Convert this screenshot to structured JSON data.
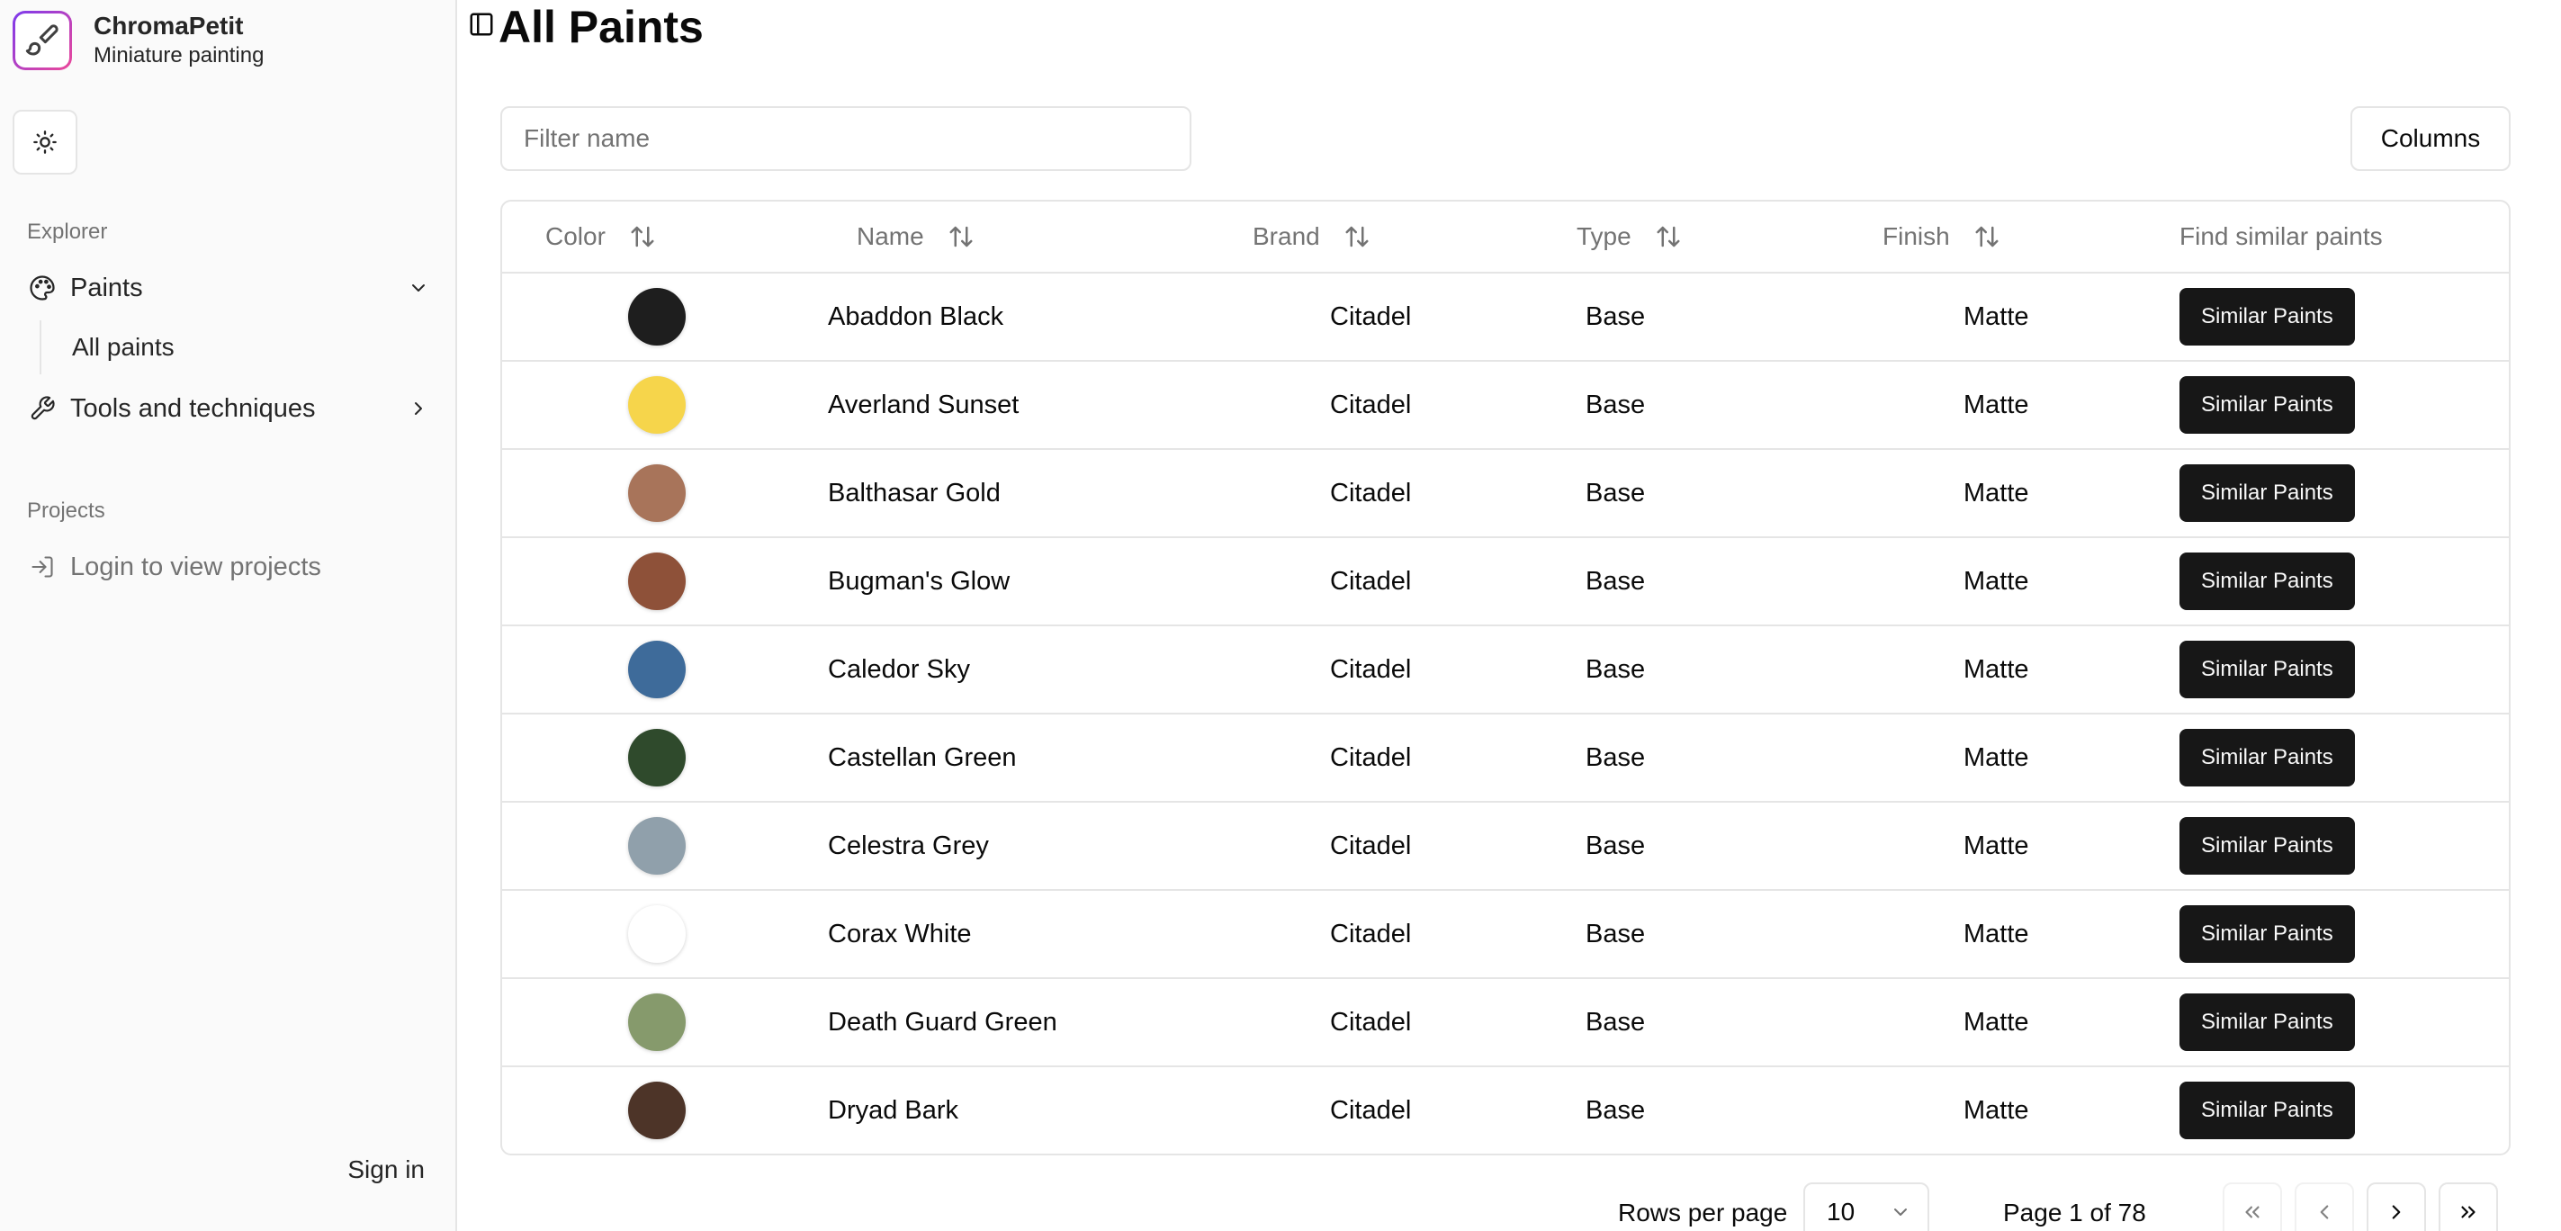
{
  "app": {
    "name": "ChromaPetit",
    "tagline": "Miniature painting"
  },
  "sidebar": {
    "explorer_label": "Explorer",
    "paints_label": "Paints",
    "all_paints_label": "All paints",
    "tools_label": "Tools and techniques",
    "projects_label": "Projects",
    "login_label": "Login to view projects",
    "sign_in_label": "Sign in"
  },
  "page": {
    "title": "All Paints"
  },
  "toolbar": {
    "filter_placeholder": "Filter name",
    "columns_label": "Columns"
  },
  "table": {
    "headers": {
      "color": "Color",
      "name": "Name",
      "brand": "Brand",
      "type": "Type",
      "finish": "Finish",
      "similar": "Find similar paints"
    },
    "button_label": "Similar Paints",
    "rows": [
      {
        "color": "#1e1e1e",
        "name": "Abaddon Black",
        "brand": "Citadel",
        "type": "Base",
        "finish": "Matte"
      },
      {
        "color": "#f6d54b",
        "name": "Averland Sunset",
        "brand": "Citadel",
        "type": "Base",
        "finish": "Matte"
      },
      {
        "color": "#a8745a",
        "name": "Balthasar Gold",
        "brand": "Citadel",
        "type": "Base",
        "finish": "Matte"
      },
      {
        "color": "#8e5139",
        "name": "Bugman's Glow",
        "brand": "Citadel",
        "type": "Base",
        "finish": "Matte"
      },
      {
        "color": "#3e6b9a",
        "name": "Caledor Sky",
        "brand": "Citadel",
        "type": "Base",
        "finish": "Matte"
      },
      {
        "color": "#2f4a2c",
        "name": "Castellan Green",
        "brand": "Citadel",
        "type": "Base",
        "finish": "Matte"
      },
      {
        "color": "#90a0ab",
        "name": "Celestra Grey",
        "brand": "Citadel",
        "type": "Base",
        "finish": "Matte"
      },
      {
        "color": "#ffffff",
        "name": "Corax White",
        "brand": "Citadel",
        "type": "Base",
        "finish": "Matte"
      },
      {
        "color": "#869a6c",
        "name": "Death Guard Green",
        "brand": "Citadel",
        "type": "Base",
        "finish": "Matte"
      },
      {
        "color": "#4d3428",
        "name": "Dryad Bark",
        "brand": "Citadel",
        "type": "Base",
        "finish": "Matte"
      }
    ]
  },
  "pagination": {
    "rows_per_page_label": "Rows per page",
    "rows_per_page_value": "10",
    "page_text": "Page 1 of 78"
  },
  "icons": {
    "logo": "paintbrush-icon",
    "theme": "sun-icon",
    "paints": "palette-icon",
    "tools": "wrench-icon",
    "login": "log-in-icon",
    "sidebar_toggle": "panel-left-icon",
    "sort": "arrow-up-down-icon"
  }
}
